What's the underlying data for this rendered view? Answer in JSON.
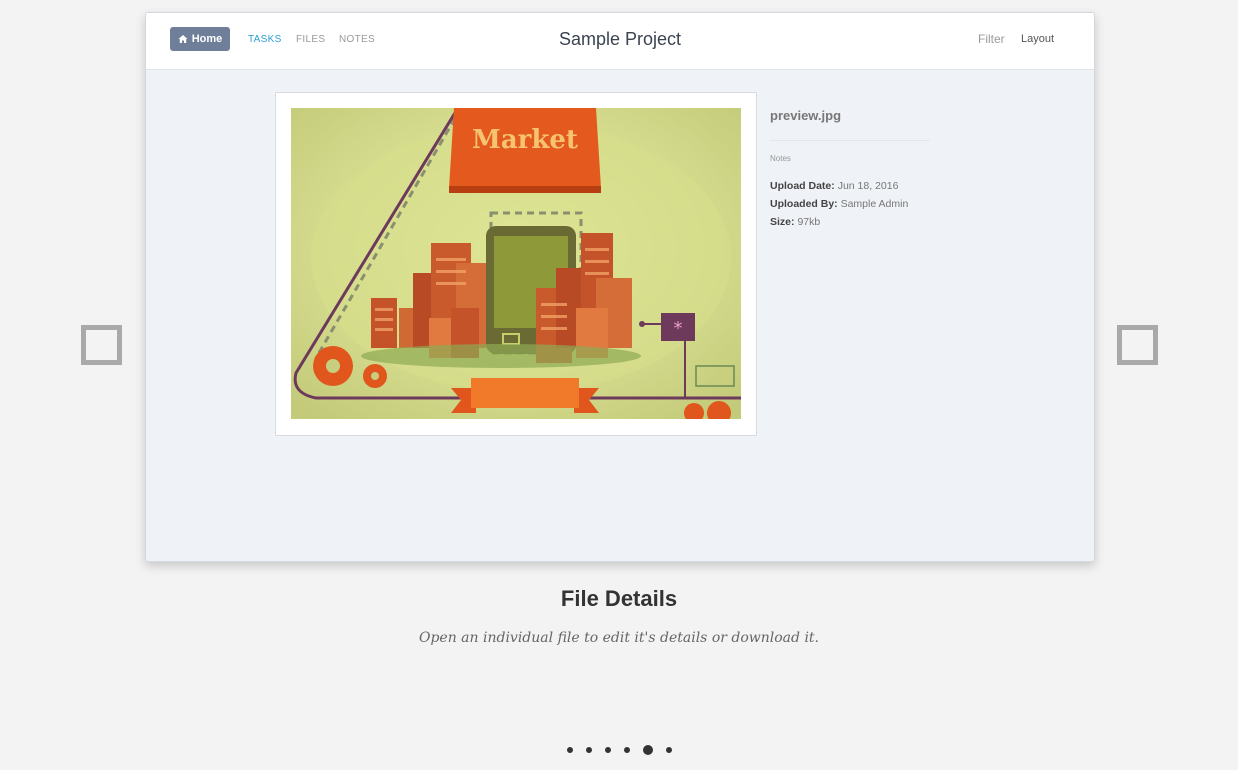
{
  "header": {
    "home_label": "Home",
    "nav": [
      "TASKS",
      "FILES",
      "NOTES"
    ],
    "project_title": "Sample Project",
    "filter_label": "Filter",
    "layout_label": "Layout"
  },
  "file": {
    "name": "preview.jpg",
    "notes_label": "Notes",
    "upload_date_label": "Upload Date:",
    "upload_date": "Jun 18, 2016",
    "uploaded_by_label": "Uploaded By:",
    "uploaded_by": "Sample Admin",
    "size_label": "Size:",
    "size": "97kb"
  },
  "image": {
    "sign_text": "Market",
    "icon": "market-illustration-image"
  },
  "slide": {
    "title": "File Details",
    "subtitle": "Open an individual file to edit it's details or download it."
  },
  "pagination": {
    "count": 6,
    "active_index": 4
  }
}
